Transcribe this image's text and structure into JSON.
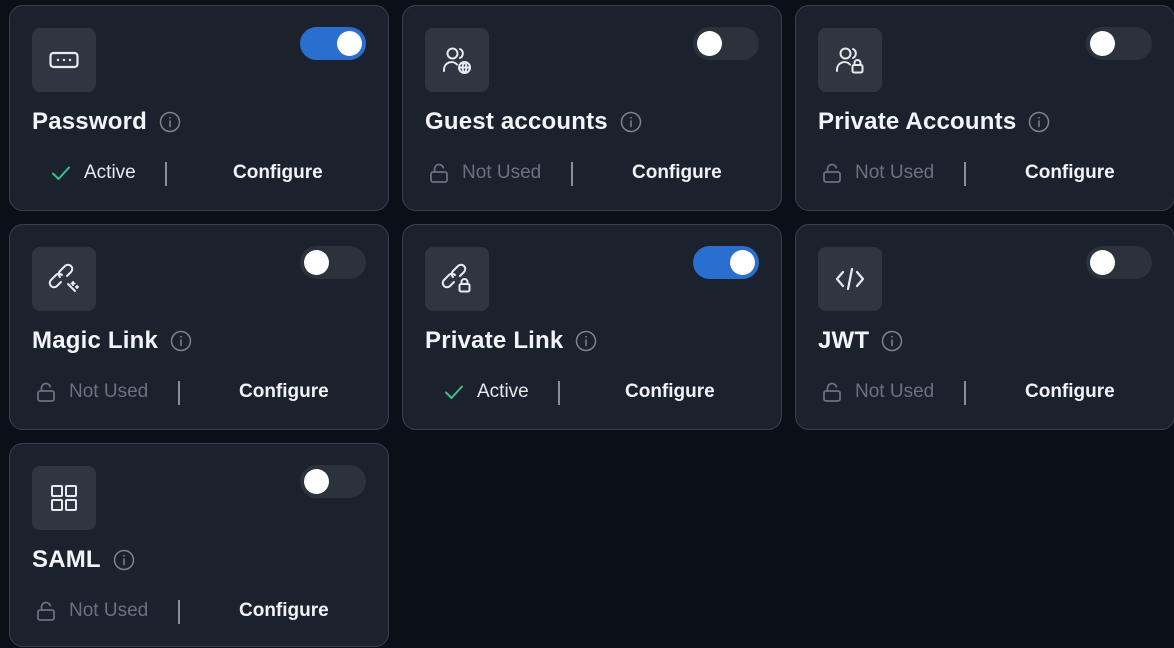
{
  "cards": [
    {
      "id": "password",
      "title": "Password",
      "enabled": true,
      "status": "Active",
      "status_type": "active",
      "configure_label": "Configure",
      "icon": "password-icon"
    },
    {
      "id": "guest-accounts",
      "title": "Guest accounts",
      "enabled": false,
      "status": "Not Used",
      "status_type": "unused",
      "configure_label": "Configure",
      "icon": "guest-user-globe-icon"
    },
    {
      "id": "private-accounts",
      "title": "Private Accounts",
      "enabled": false,
      "status": "Not Used",
      "status_type": "unused",
      "configure_label": "Configure",
      "icon": "user-lock-icon"
    },
    {
      "id": "magic-link",
      "title": "Magic Link",
      "enabled": false,
      "status": "Not Used",
      "status_type": "unused",
      "configure_label": "Configure",
      "icon": "magic-link-icon"
    },
    {
      "id": "private-link",
      "title": "Private Link",
      "enabled": true,
      "status": "Active",
      "status_type": "active",
      "configure_label": "Configure",
      "icon": "link-lock-icon"
    },
    {
      "id": "jwt",
      "title": "JWT",
      "enabled": false,
      "status": "Not Used",
      "status_type": "unused",
      "configure_label": "Configure",
      "icon": "code-icon"
    },
    {
      "id": "saml",
      "title": "SAML",
      "enabled": false,
      "status": "Not Used",
      "status_type": "unused",
      "configure_label": "Configure",
      "icon": "grid-icon"
    }
  ],
  "colors": {
    "background": "#0b0f17",
    "card": "#1b222d",
    "toggle_on": "#2a6fd0",
    "toggle_off": "#2c323c",
    "active_check": "#3fbf8a",
    "muted_text": "#6a7180"
  }
}
